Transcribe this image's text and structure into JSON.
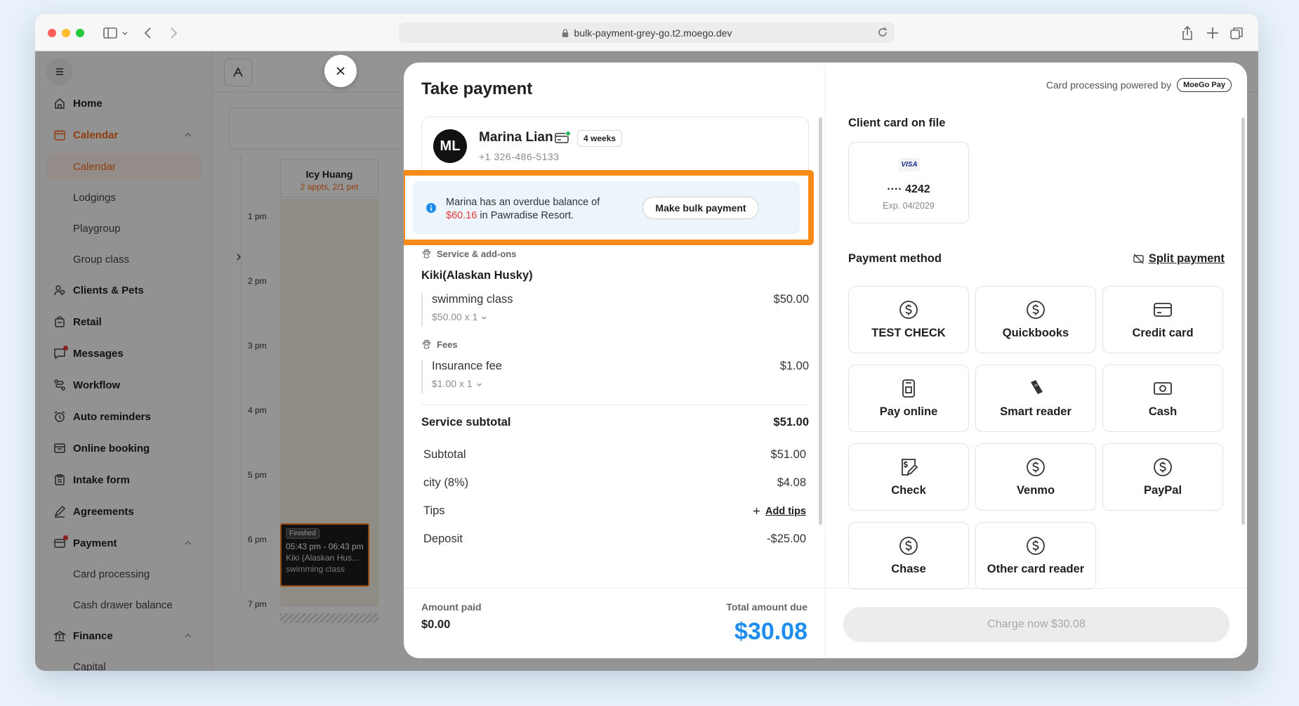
{
  "browser": {
    "url": "bulk-payment-grey-go.t2.moego.dev"
  },
  "sidebar": {
    "items": [
      {
        "label": "Home"
      },
      {
        "label": "Calendar"
      },
      {
        "label": "Calendar"
      },
      {
        "label": "Lodgings"
      },
      {
        "label": "Playgroup"
      },
      {
        "label": "Group class"
      },
      {
        "label": "Clients & Pets"
      },
      {
        "label": "Retail"
      },
      {
        "label": "Messages"
      },
      {
        "label": "Workflow"
      },
      {
        "label": "Auto reminders"
      },
      {
        "label": "Online booking"
      },
      {
        "label": "Intake form"
      },
      {
        "label": "Agreements"
      },
      {
        "label": "Payment"
      },
      {
        "label": "Card processing"
      },
      {
        "label": "Cash drawer balance"
      },
      {
        "label": "Finance"
      },
      {
        "label": "Capital"
      }
    ]
  },
  "calendar": {
    "staff_name": "Icy Huang",
    "staff_sub": "2 appts, 2/1 pet",
    "times": [
      "1 pm",
      "2 pm",
      "3 pm",
      "4 pm",
      "5 pm",
      "6 pm",
      "7 pm"
    ],
    "appt": {
      "status": "Finished",
      "time": "05:43 pm - 06:43 pm",
      "pet": "Kiki (Alaskan Hus...",
      "service": "swimming class"
    }
  },
  "modal": {
    "title": "Take payment",
    "client": {
      "initials": "ML",
      "name": "Marina Lian",
      "phone": "+1 326-486-5133",
      "badge": "4 weeks"
    },
    "notice": {
      "pre": "Marina has an overdue balance of ",
      "amount": "$60.16",
      "post": " in Pawradise Resort.",
      "button": "Make bulk payment"
    },
    "service_section": "Service & add-ons",
    "pet": "Kiki(Alaskan Husky)",
    "services": [
      {
        "name": "swimming class",
        "price": "$50.00 x 1",
        "amount": "$50.00"
      }
    ],
    "fees_section": "Fees",
    "fees": [
      {
        "name": "Insurance fee",
        "price": "$1.00 x 1",
        "amount": "$1.00"
      }
    ],
    "service_subtotal": {
      "label": "Service subtotal",
      "value": "$51.00"
    },
    "summary": [
      {
        "label": "Subtotal",
        "value": "$51.00"
      },
      {
        "label": "city (8%)",
        "value": "$4.08"
      },
      {
        "label": "Tips",
        "value": "Add tips"
      },
      {
        "label": "Deposit",
        "value": "-$25.00"
      }
    ],
    "amount_paid_label": "Amount paid",
    "amount_paid": "$0.00",
    "total_due_label": "Total amount due",
    "total_due": "$30.08",
    "powered_by": "Card processing powered by",
    "powered_brand": "MoeGo Pay",
    "card_on_file_label": "Client card on file",
    "card": {
      "brand": "VISA",
      "number": "···· 4242",
      "exp": "Exp. 04/2029"
    },
    "payment_method_label": "Payment method",
    "split_payment": "Split payment",
    "methods": [
      {
        "label": "TEST CHECK",
        "icon": "dollar-circle-icon"
      },
      {
        "label": "Quickbooks",
        "icon": "dollar-circle-icon"
      },
      {
        "label": "Credit card",
        "icon": "credit-card-icon"
      },
      {
        "label": "Pay online",
        "icon": "pay-online-icon"
      },
      {
        "label": "Smart reader",
        "icon": "card-reader-icon"
      },
      {
        "label": "Cash",
        "icon": "cash-icon"
      },
      {
        "label": "Check",
        "icon": "check-icon"
      },
      {
        "label": "Venmo",
        "icon": "dollar-circle-icon"
      },
      {
        "label": "PayPal",
        "icon": "dollar-circle-icon"
      },
      {
        "label": "Chase",
        "icon": "dollar-circle-icon"
      },
      {
        "label": "Other card reader",
        "icon": "dollar-circle-icon"
      }
    ],
    "charge_button": "Charge now $30.08"
  },
  "colors": {
    "accent_orange": "#f96b18",
    "highlight_orange": "#f98b16",
    "total_blue": "#1f8cf0",
    "overdue_red": "#e5393a"
  }
}
